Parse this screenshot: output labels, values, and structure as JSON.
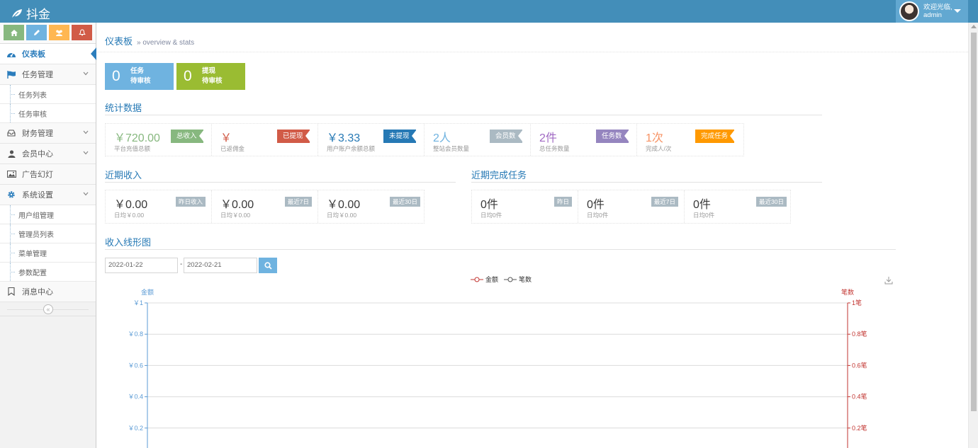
{
  "navbar": {
    "brand": "抖金",
    "user": {
      "welcome": "欢迎光临,",
      "name": "admin"
    }
  },
  "sidebar": {
    "items": [
      {
        "label": "仪表板",
        "icon": "dashboard-icon",
        "active": true
      },
      {
        "label": "任务管理",
        "icon": "flag-icon",
        "children": [
          "任务列表",
          "任务审核"
        ]
      },
      {
        "label": "财务管理",
        "icon": "inbox-icon"
      },
      {
        "label": "会员中心",
        "icon": "user-icon"
      },
      {
        "label": "广告幻灯",
        "icon": "picture-icon"
      },
      {
        "label": "系统设置",
        "icon": "cog-icon",
        "children": [
          "用户组管理",
          "管理员列表",
          "菜单管理",
          "参数配置"
        ]
      },
      {
        "label": "消息中心",
        "icon": "bookmark-icon"
      }
    ],
    "collapse": "«"
  },
  "page": {
    "title": "仪表板",
    "subtitle": "» overview & stats"
  },
  "infoboxes": [
    {
      "num": "0",
      "line1": "任务",
      "line2": "待审核",
      "color": "#6fb3e0"
    },
    {
      "num": "0",
      "line1": "提现",
      "line2": "待审核",
      "color": "#9abc32"
    }
  ],
  "stats": {
    "title": "统计数据",
    "cells": [
      {
        "value": "￥720.00",
        "desc": "平台充值总额",
        "tag": "总收入",
        "value_color": "#87b87f",
        "tag_color": "#87b87f"
      },
      {
        "value": "￥",
        "desc": "已返佣金",
        "tag": "已提现",
        "value_color": "#d15b47",
        "tag_color": "#d15b47"
      },
      {
        "value": "￥3.33",
        "desc": "用户账户余额总额",
        "tag": "未提现",
        "value_color": "#2679b5",
        "tag_color": "#2679b5"
      },
      {
        "value": "2人",
        "desc": "整站会员数量",
        "tag": "会员数",
        "value_color": "#6fb3e0",
        "tag_color": "#abbac3"
      },
      {
        "value": "2件",
        "desc": "总任务数量",
        "tag": "任务数",
        "value_color": "#a069c3",
        "tag_color": "#9585bf"
      },
      {
        "value": "1次",
        "desc": "完成人/次",
        "tag": "完成任务",
        "value_color": "#f79263",
        "tag_color": "#ff9900"
      }
    ]
  },
  "recent_income": {
    "title": "近期收入",
    "cells": [
      {
        "value": "￥0.00",
        "desc": "日均￥0.00",
        "tag": "昨日收入"
      },
      {
        "value": "￥0.00",
        "desc": "日均￥0.00",
        "tag": "最近7日"
      },
      {
        "value": "￥0.00",
        "desc": "日均￥0.00",
        "tag": "最近30日"
      }
    ]
  },
  "recent_tasks": {
    "title": "近期完成任务",
    "cells": [
      {
        "value": "0件",
        "desc": "日均0件",
        "tag": "昨日"
      },
      {
        "value": "0件",
        "desc": "日均0件",
        "tag": "最近7日"
      },
      {
        "value": "0件",
        "desc": "日均0件",
        "tag": "最近30日"
      }
    ]
  },
  "line_chart_section": {
    "title": "收入线形图",
    "start_date": "2022-01-22",
    "separator": "-",
    "end_date": "2022-02-21"
  },
  "chart_data": {
    "type": "line",
    "title": "",
    "ylabel": "金额",
    "y2label": "笔数",
    "ylim": [
      0,
      1
    ],
    "y2lim": [
      0,
      1
    ],
    "yticks": [
      "￥0.2",
      "￥0.4",
      "￥0.6",
      "￥0.8",
      "￥1"
    ],
    "y2ticks": [
      "0.2笔",
      "0.4笔",
      "0.6笔",
      "0.8笔",
      "1笔"
    ],
    "tick_values": [
      0.2,
      0.4,
      0.6,
      0.8,
      1
    ],
    "series": [
      {
        "name": "金额",
        "values": [],
        "color": "#5b9bd5"
      },
      {
        "name": "笔数",
        "values": [],
        "color": "#555555"
      }
    ],
    "axis_colors": {
      "left": "#5b9bd5",
      "right": "#c23531"
    },
    "legend": "top-center",
    "grid": true
  }
}
